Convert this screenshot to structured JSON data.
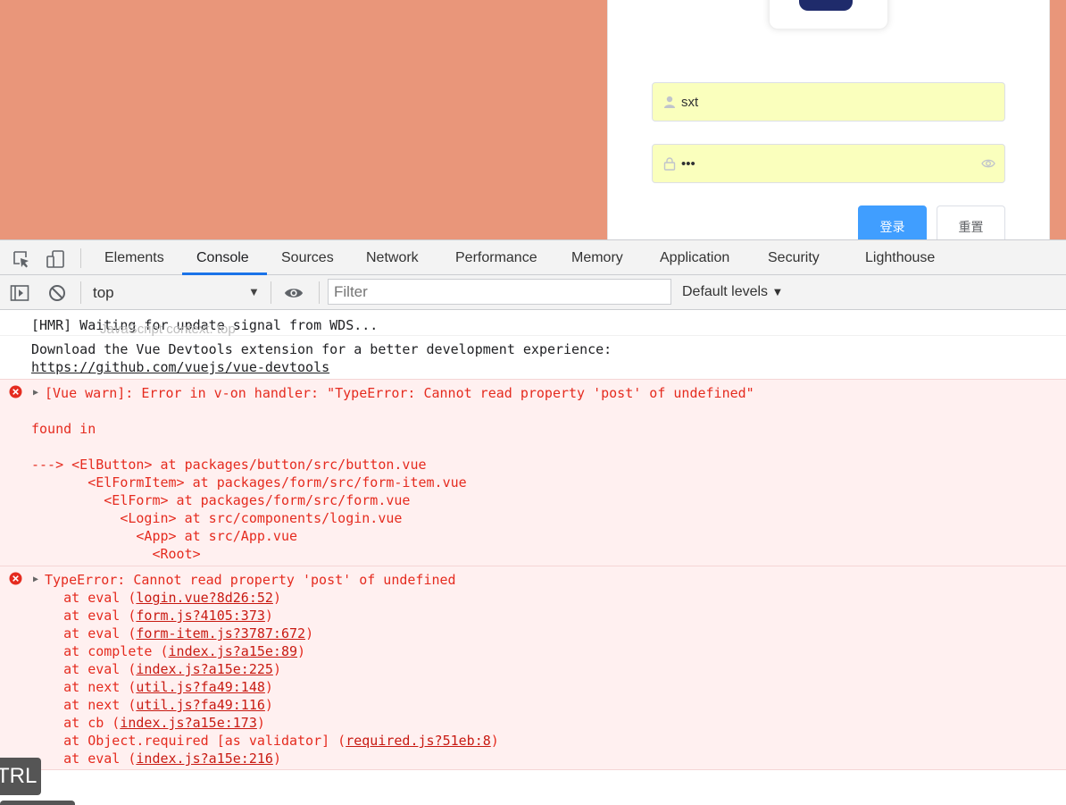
{
  "login": {
    "username_value": "sxt",
    "password_mask": "•••",
    "login_button": "登录",
    "reset_button": "重置"
  },
  "devtools": {
    "tabs": [
      "Elements",
      "Console",
      "Sources",
      "Network",
      "Performance",
      "Memory",
      "Application",
      "Security",
      "Lighthouse"
    ],
    "active_tab": "Console",
    "context": "top",
    "context_hint": "JavaScript context: top",
    "filter_placeholder": "Filter",
    "levels": "Default levels"
  },
  "console": {
    "hmr": "[HMR] Waiting for update signal from WDS...",
    "devtools_msg": "Download the Vue Devtools extension for a better development experience:",
    "devtools_link": "https://github.com/vuejs/vue-devtools",
    "vue_warn": "[Vue warn]: Error in v-on handler: \"TypeError: Cannot read property 'post' of undefined\"",
    "found_in": "found in",
    "trace": [
      "---> <ElButton> at packages/button/src/button.vue",
      "       <ElFormItem> at packages/form/src/form-item.vue",
      "         <ElForm> at packages/form/src/form.vue",
      "           <Login> at src/components/login.vue",
      "             <App> at src/App.vue",
      "               <Root>"
    ],
    "type_error": "TypeError: Cannot read property 'post' of undefined",
    "stack": [
      {
        "prefix": "    at eval (",
        "link": "login.vue?8d26:52",
        "suffix": ")"
      },
      {
        "prefix": "    at eval (",
        "link": "form.js?4105:373",
        "suffix": ")"
      },
      {
        "prefix": "    at eval (",
        "link": "form-item.js?3787:672",
        "suffix": ")"
      },
      {
        "prefix": "    at complete (",
        "link": "index.js?a15e:89",
        "suffix": ")"
      },
      {
        "prefix": "    at eval (",
        "link": "index.js?a15e:225",
        "suffix": ")"
      },
      {
        "prefix": "    at next (",
        "link": "util.js?fa49:148",
        "suffix": ")"
      },
      {
        "prefix": "    at next (",
        "link": "util.js?fa49:116",
        "suffix": ")"
      },
      {
        "prefix": "    at cb (",
        "link": "index.js?a15e:173",
        "suffix": ")"
      },
      {
        "prefix": "    at Object.required [as validator] (",
        "link": "required.js?51eb:8",
        "suffix": ")"
      },
      {
        "prefix": "    at eval (",
        "link": "index.js?a15e:216",
        "suffix": ")"
      }
    ]
  },
  "overlay": {
    "key_badge": "TRL"
  },
  "colors": {
    "app_background": "#e9967a",
    "primary_button": "#409eff",
    "autofill": "#faffbd",
    "error_text": "#e52b1f",
    "error_background": "#fff0f0",
    "tab_underline": "#1a73e8"
  }
}
